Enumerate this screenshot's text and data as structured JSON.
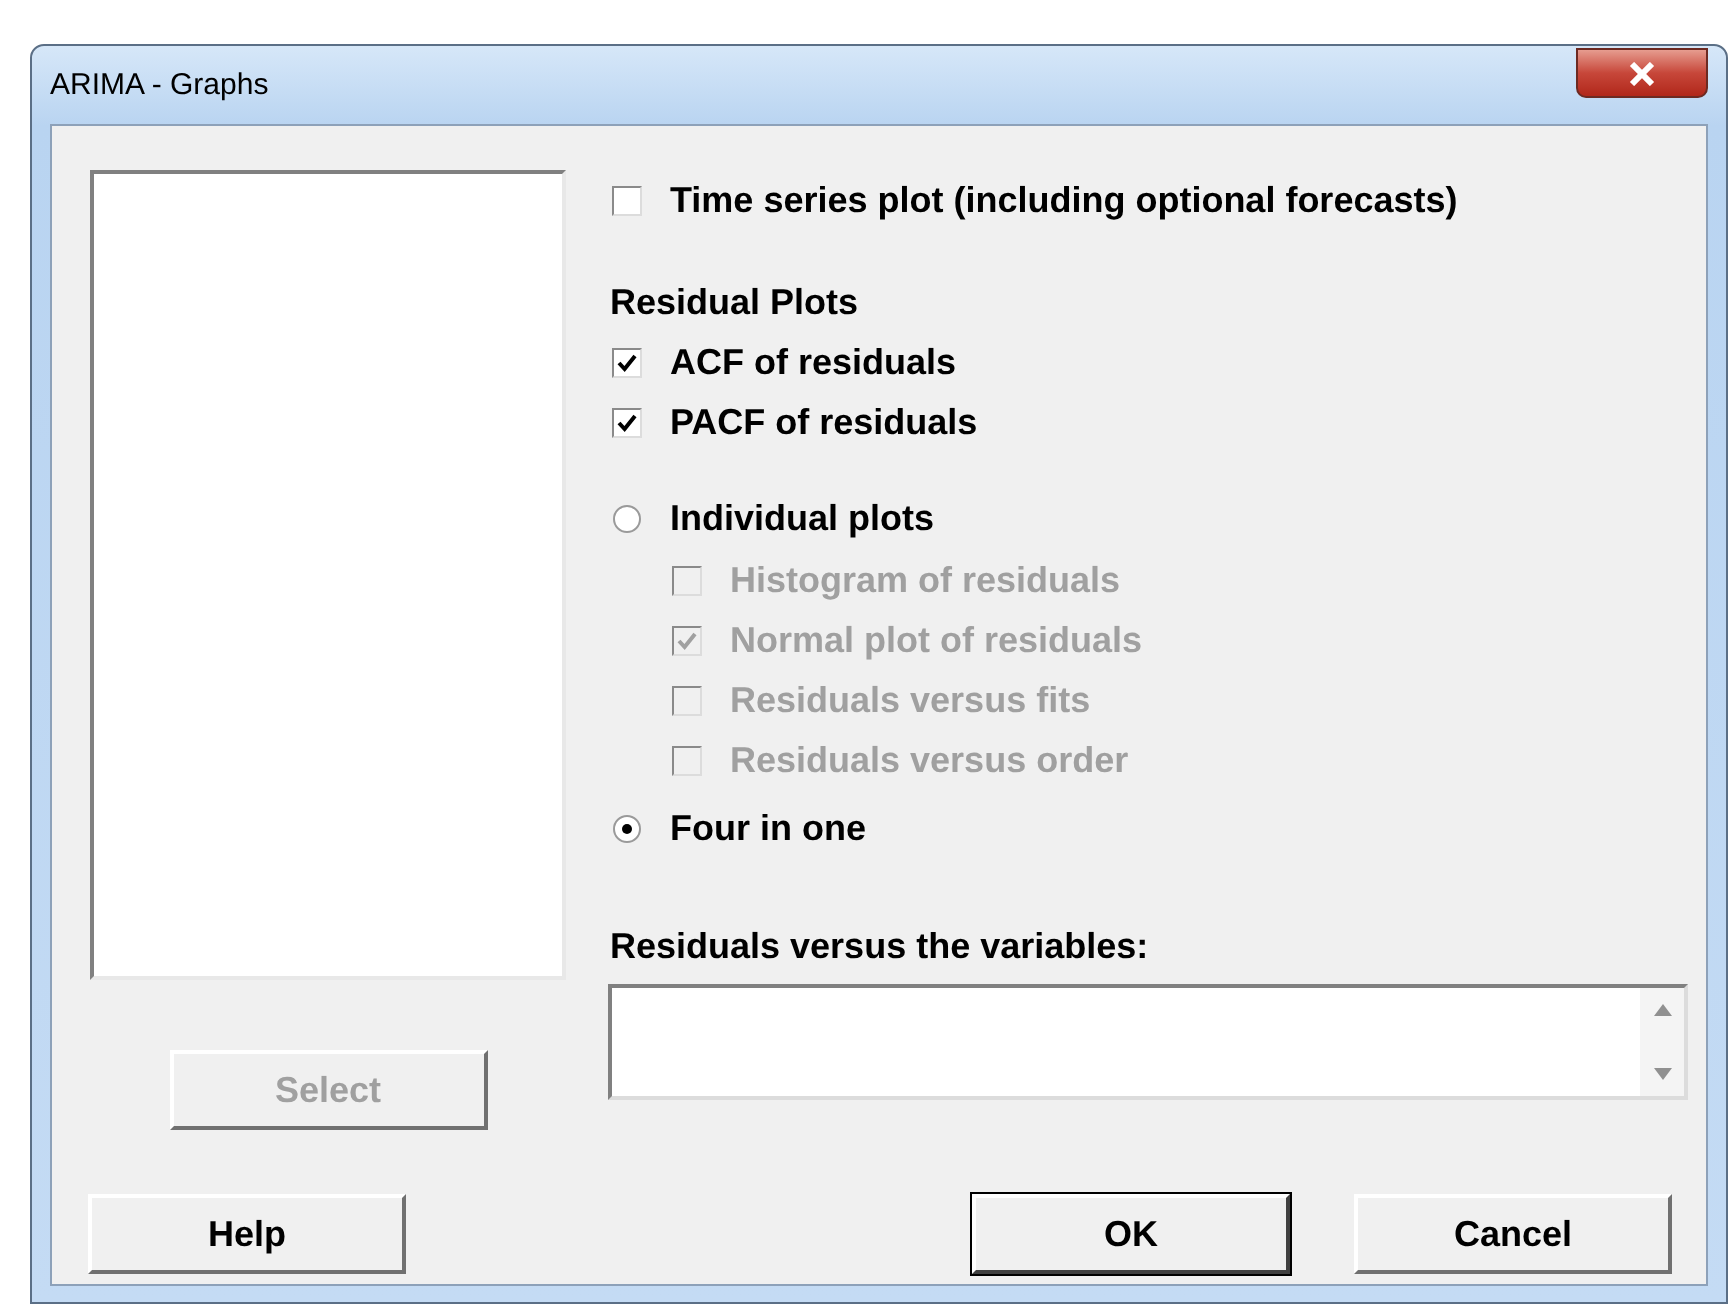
{
  "window": {
    "title": "ARIMA - Graphs"
  },
  "time_series": {
    "label": "Time series plot (including optional forecasts)",
    "checked": false
  },
  "residual_plots": {
    "heading": "Residual Plots",
    "items": [
      {
        "label": "ACF of residuals",
        "checked": true
      },
      {
        "label": "PACF of residuals",
        "checked": true
      }
    ]
  },
  "plot_layout": [
    {
      "label": "Individual plots",
      "selected": false,
      "children": [
        {
          "label": "Histogram of residuals",
          "checked": false,
          "disabled": true
        },
        {
          "label": "Normal plot of residuals",
          "checked": true,
          "disabled": true
        },
        {
          "label": "Residuals versus fits",
          "checked": false,
          "disabled": true
        },
        {
          "label": "Residuals versus order",
          "checked": false,
          "disabled": true
        }
      ]
    },
    {
      "label": "Four in one",
      "selected": true
    }
  ],
  "variables": {
    "label": "Residuals versus the variables:"
  },
  "select_button": {
    "label": "Select",
    "disabled": true
  },
  "buttons": [
    {
      "label": "Help",
      "default": false
    },
    {
      "label": "OK",
      "default": true
    },
    {
      "label": "Cancel",
      "default": false
    }
  ]
}
